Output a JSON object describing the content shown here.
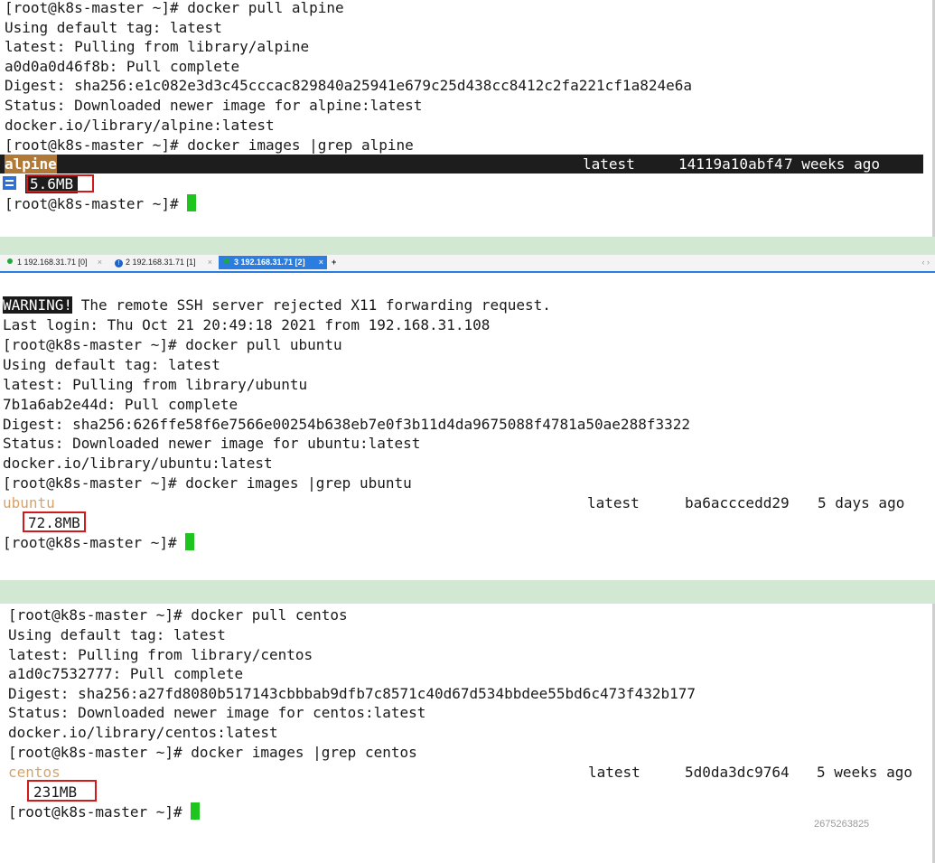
{
  "top_pane": {
    "lines": [
      "[root@k8s-master ~]# docker pull alpine",
      "Using default tag: latest",
      "latest: Pulling from library/alpine",
      "a0d0a0d46f8b: Pull complete",
      "Digest: sha256:e1c082e3d3c45cccac829840a25941e679c25d438cc8412c2fa221cf1a824e6a",
      "Status: Downloaded newer image for alpine:latest",
      "docker.io/library/alpine:latest",
      "[root@k8s-master ~]# docker images |grep alpine"
    ],
    "result": {
      "repo": "alpine",
      "tag": "latest",
      "image_id": "14119a10abf4",
      "created": "7 weeks ago",
      "size": "5.6MB"
    },
    "prompt": "[root@k8s-master ~]# "
  },
  "tabs": [
    {
      "label": "1 192.168.31.71 [0]",
      "status": "connected"
    },
    {
      "label": "2 192.168.31.71 [1]",
      "status": "info"
    },
    {
      "label": "3 192.168.31.71 [2]",
      "status": "connected",
      "active": true
    }
  ],
  "tab_new_label": "+",
  "tab_close_glyph": "×",
  "tab_scroll_glyph": "‹ ›",
  "middle_pane": {
    "warning_tag": "WARNING!",
    "warning_text": " The remote SSH server rejected X11 forwarding request.",
    "lines": [
      "Last login: Thu Oct 21 20:49:18 2021 from 192.168.31.108",
      "[root@k8s-master ~]# docker pull ubuntu",
      "Using default tag: latest",
      "latest: Pulling from library/ubuntu",
      "7b1a6ab2e44d: Pull complete",
      "Digest: sha256:626ffe58f6e7566e00254b638eb7e0f3b11d4da9675088f4781a50ae288f3322",
      "Status: Downloaded newer image for ubuntu:latest",
      "docker.io/library/ubuntu:latest",
      "[root@k8s-master ~]# docker images |grep ubuntu"
    ],
    "result": {
      "repo": "ubuntu",
      "tag": "latest",
      "image_id": "ba6acccedd29",
      "created": "5 days ago",
      "size": "72.8MB"
    },
    "prompt": "[root@k8s-master ~]# "
  },
  "bottom_pane": {
    "lines": [
      "[root@k8s-master ~]# docker pull centos",
      "Using default tag: latest",
      "latest: Pulling from library/centos",
      "a1d0c7532777: Pull complete",
      "Digest: sha256:a27fd8080b517143cbbbab9dfb7c8571c40d67d534bbdee55bd6c473f432b177",
      "Status: Downloaded newer image for centos:latest",
      "docker.io/library/centos:latest",
      "[root@k8s-master ~]# docker images |grep centos"
    ],
    "result": {
      "repo": "centos",
      "tag": "latest",
      "image_id": "5d0da3dc9764",
      "created": "5 weeks ago",
      "size": "231MB"
    },
    "prompt": "[root@k8s-master ~]# "
  },
  "watermark": "2675263825",
  "colors": {
    "cursor": "#1ec51e",
    "highlight_box": "#d11a1a",
    "separator": "#d3e8d3",
    "tab_active": "#2b7de0",
    "repo_text": "#d6a46a"
  }
}
